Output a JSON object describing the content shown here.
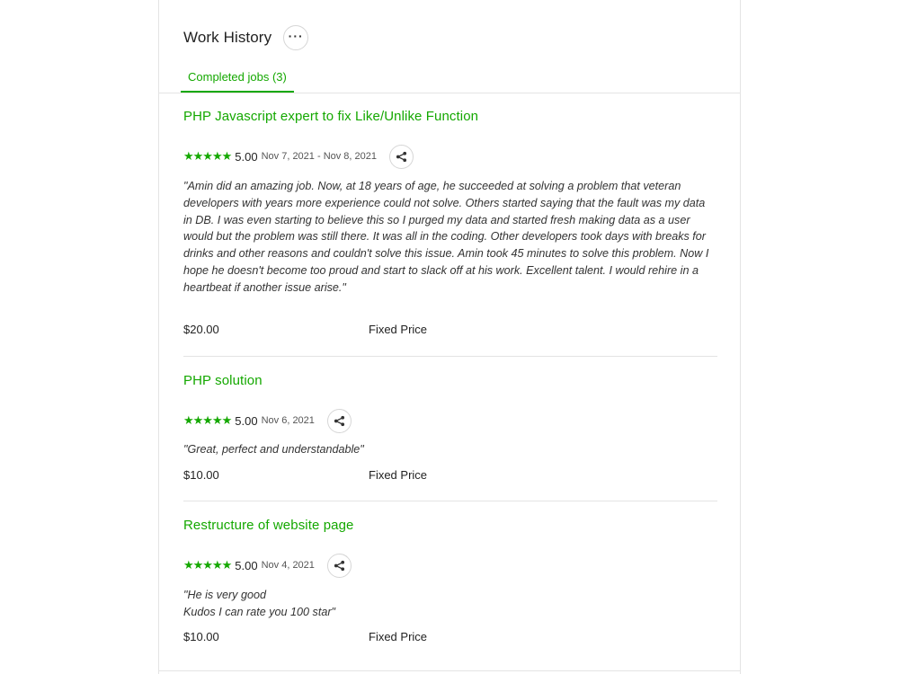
{
  "section": {
    "title": "Work History",
    "more_icon": "more-horizontal-icon",
    "tab_label": "Completed jobs (3)"
  },
  "colors": {
    "accent": "#14a800",
    "divider": "#e4e4e4"
  },
  "jobs": [
    {
      "title": "PHP Javascript expert to fix Like/Unlike Function",
      "stars": "★★★★★",
      "score": "5.00",
      "dates": "Nov 7, 2021 - Nov 8, 2021",
      "feedback": "\"Amin did an amazing job. Now, at 18 years of age, he succeeded at solving a problem that veteran developers with years more experience could not solve. Others started saying that the fault was my data in DB. I was even starting to believe this so I purged my data and started fresh making data as a user would but the problem was still there. It was all in the coding. Other developers took days with breaks for drinks and other reasons and couldn't solve this issue. Amin took 45 minutes to solve this problem. Now I hope he doesn't become too proud and start to slack off at his work. Excellent talent. I would rehire in a heartbeat if another issue arise.\"",
      "price": "$20.00",
      "price_type": "Fixed Price"
    },
    {
      "title": "PHP solution",
      "stars": "★★★★★",
      "score": "5.00",
      "dates": "Nov 6, 2021",
      "feedback": "\"Great, perfect and understandable\"",
      "price": "$10.00",
      "price_type": "Fixed Price"
    },
    {
      "title": "Restructure of website page",
      "stars": "★★★★★",
      "score": "5.00",
      "dates": "Nov 4, 2021",
      "feedback": "\"He is very good\nKudos I can rate you 100 star\"",
      "price": "$10.00",
      "price_type": "Fixed Price"
    }
  ]
}
